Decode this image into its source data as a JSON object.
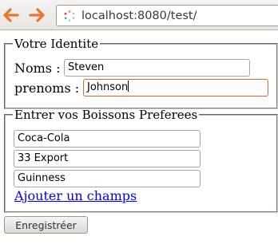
{
  "browser": {
    "url": "localhost:8080/test/"
  },
  "form": {
    "identity": {
      "legend": "Votre Identite",
      "nom_label": "Noms :",
      "nom_value": "Steven",
      "prenom_label": "prenoms :",
      "prenom_value": "Johnson"
    },
    "drinks": {
      "legend": "Entrer vos Boissons Preferees",
      "items": [
        "Coca-Cola",
        "33 Export",
        "Guinness"
      ],
      "add_link": "Ajouter un champs"
    },
    "submit_label": "Enregistréer"
  },
  "colors": {
    "nav_arrow": "#e8762c",
    "focus_border": "#e06a2b",
    "link": "#0000ee"
  },
  "icons": {
    "back": "left-arrow-icon",
    "forward": "right-arrow-icon",
    "loading": "loading-spinner-icon"
  }
}
